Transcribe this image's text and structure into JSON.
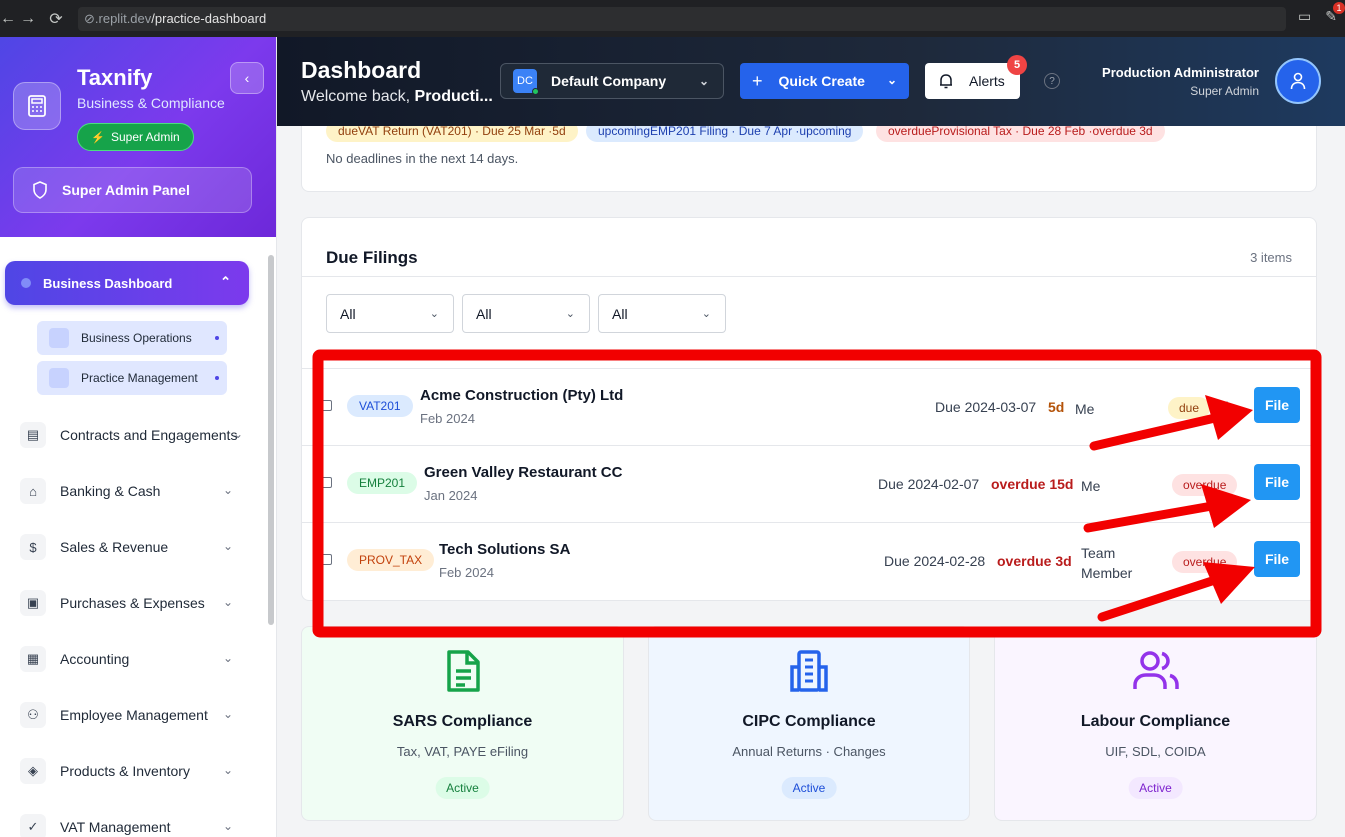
{
  "browser": {
    "url_prefix": ".replit.dev",
    "url_path": "/practice-dashboard",
    "ext_badge": "1"
  },
  "sidebar": {
    "brand": "Taxnify",
    "brand_sub": "Business & Compliance",
    "role_badge": "Super Admin",
    "admin_panel": "Super Admin Panel",
    "active_item": "Business Dashboard",
    "sub_items": [
      "Business Operations",
      "Practice Management"
    ],
    "items": [
      {
        "label": "Contracts and Engagements",
        "icon": "document-icon"
      },
      {
        "label": "Banking & Cash",
        "icon": "bank-icon"
      },
      {
        "label": "Sales & Revenue",
        "icon": "dollar-icon"
      },
      {
        "label": "Purchases & Expenses",
        "icon": "receipt-icon"
      },
      {
        "label": "Accounting",
        "icon": "calculator-icon"
      },
      {
        "label": "Employee Management",
        "icon": "users-icon"
      },
      {
        "label": "Products & Inventory",
        "icon": "box-icon"
      },
      {
        "label": "VAT Management",
        "icon": "vat-icon"
      }
    ]
  },
  "header": {
    "title": "Dashboard",
    "welcome": "Welcome back, ",
    "welcome_name": "Producti...",
    "company_initials": "DC",
    "company": "Default Company",
    "quick_create": "Quick Create",
    "alerts": "Alerts",
    "alerts_count": "5",
    "user_name": "Production Administrator",
    "user_role": "Super Admin"
  },
  "deadlines": {
    "chips": [
      {
        "text": "dueVAT Return (VAT201) · Due 25 Mar ·5d",
        "bg": "#fef3c7",
        "fg": "#92400e"
      },
      {
        "text": "upcomingEMP201 Filing · Due 7 Apr ·upcoming",
        "bg": "#dbeafe",
        "fg": "#1e40af"
      },
      {
        "text": "overdueProvisional Tax · Due 28 Feb ·overdue 3d",
        "bg": "#fee2e2",
        "fg": "#b91c1c"
      }
    ],
    "empty_text": "No deadlines in the next 14 days."
  },
  "due_filings": {
    "title": "Due Filings",
    "count": "3 items",
    "filters": [
      "All",
      "All",
      "All"
    ],
    "rows": [
      {
        "type": "VAT201",
        "client": "Acme Construction (Pty) Ltd",
        "period": "Feb 2024",
        "due": "Due 2024-03-07",
        "days": "5d",
        "assignee": "Me",
        "status": "due",
        "action": "File"
      },
      {
        "type": "EMP201",
        "client": "Green Valley Restaurant CC",
        "period": "Jan 2024",
        "due": "Due 2024-02-07",
        "days": "overdue 15d",
        "assignee": "Me",
        "status": "overdue",
        "action": "File"
      },
      {
        "type": "PROV_TAX",
        "client": "Tech Solutions SA",
        "period": "Feb 2024",
        "due": "Due 2024-02-28",
        "days": "overdue 3d",
        "assignee": "Team Member",
        "status": "overdue",
        "action": "File"
      }
    ]
  },
  "compliance": [
    {
      "title": "SARS Compliance",
      "sub": "Tax, VAT, PAYE eFiling",
      "status": "Active",
      "icon": "file-text-icon",
      "color": "#16a34a"
    },
    {
      "title": "CIPC Compliance",
      "sub": "Annual Returns · Changes",
      "status": "Active",
      "icon": "building-icon",
      "color": "#2563eb"
    },
    {
      "title": "Labour Compliance",
      "sub": "UIF, SDL, COIDA",
      "status": "Active",
      "icon": "users-icon",
      "color": "#9333ea"
    }
  ],
  "annotation_color": "#f20000"
}
